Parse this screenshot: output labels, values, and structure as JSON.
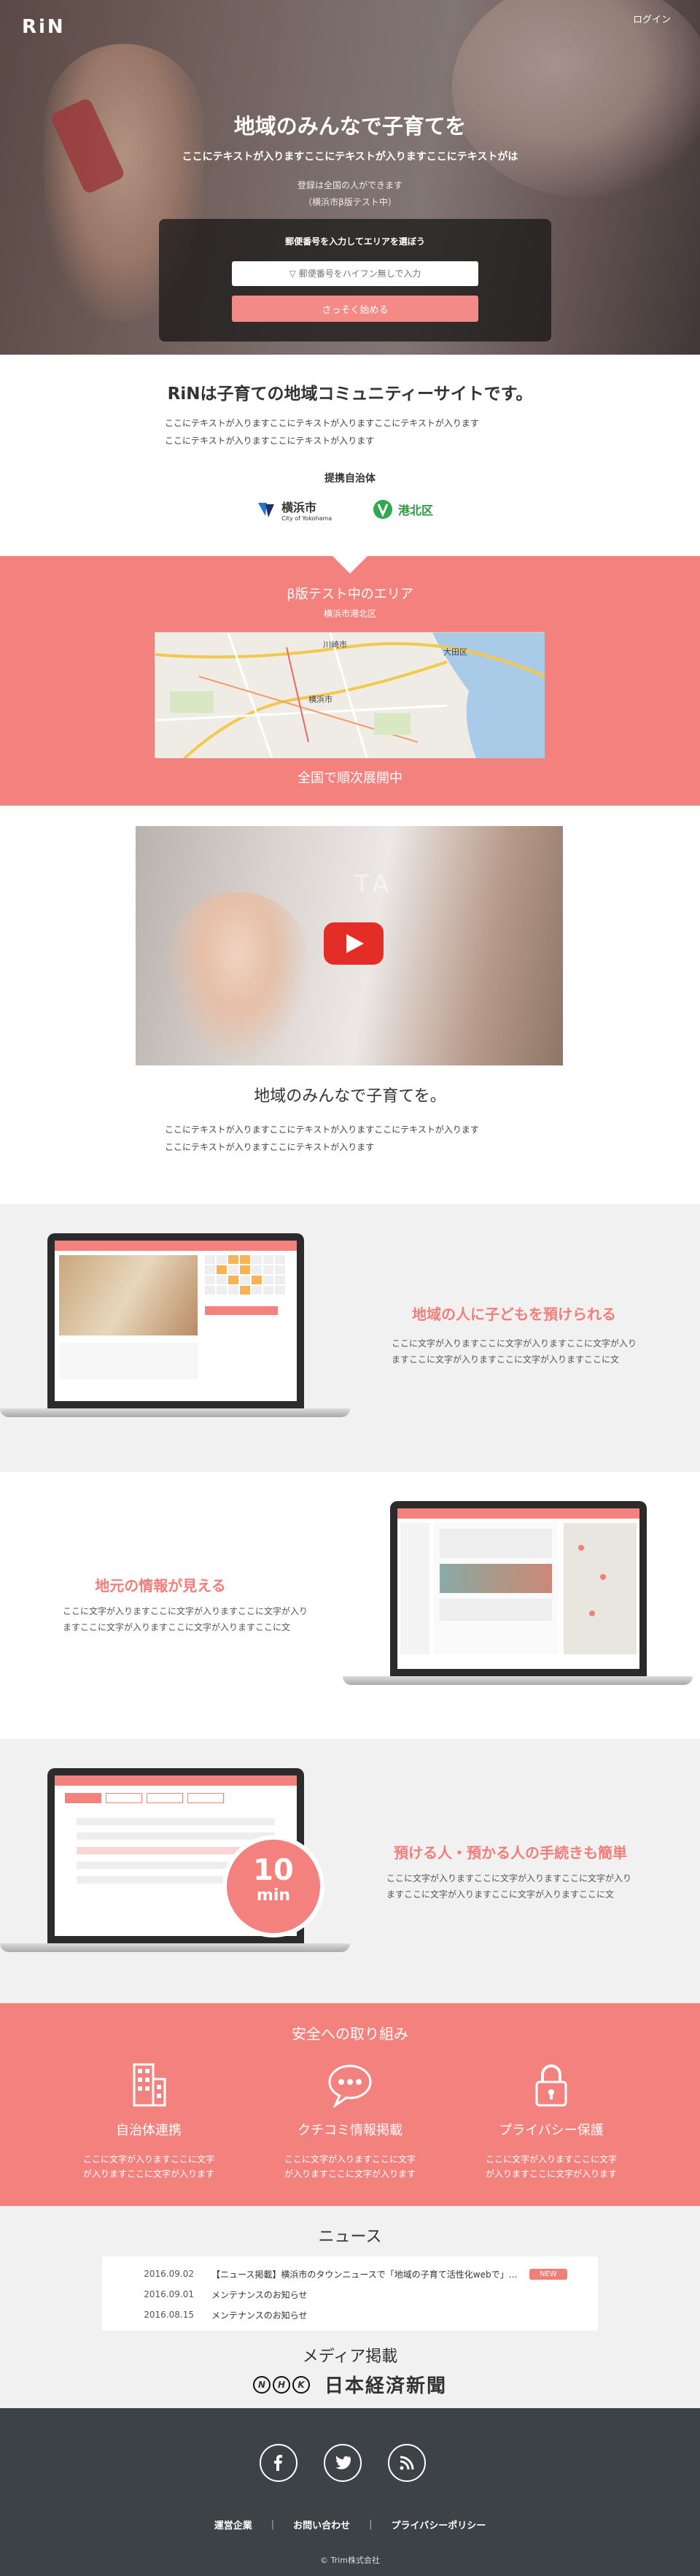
{
  "header": {
    "logo": "RiN",
    "login": "ログイン"
  },
  "hero": {
    "title": "地域のみんなで子育てを",
    "subtitle": "ここにテキストが入りますここにテキストが入りますここにテキストがは",
    "note1": "登録は全国の人ができます",
    "note2": "（横浜市β版テスト中）",
    "panel_label": "郵便番号を入力してエリアを選ぼう",
    "zip_placeholder": "▽ 郵便番号をハイフン無しで入力",
    "start_button": "さっそく始める"
  },
  "intro": {
    "title": "RiNは子育ての地域コミュニティーサイトです。",
    "text1": "ここにテキストが入りますここにテキストが入りますここにテキストが入ります",
    "text2": "ここにテキストが入りますここにテキストが入ります",
    "partners_label": "提携自治体",
    "partners": [
      {
        "name": "横浜市",
        "sub": "City of Yokohama"
      },
      {
        "name": "港北区"
      }
    ]
  },
  "trial": {
    "title": "β版テスト中のエリア",
    "area": "横浜市港北区",
    "map_labels": [
      "川崎市",
      "大田区",
      "横浜市"
    ],
    "footer": "全国で順次展開中"
  },
  "video_section": {
    "title": "地域のみんなで子育てを。",
    "text1": "ここにテキストが入りますここにテキストが入りますここにテキストが入ります",
    "text2": "ここにテキストが入りますここにテキストが入ります",
    "watermark": "TA"
  },
  "features": [
    {
      "title": "地域の人に子どもを預けられる",
      "text1": "ここに文字が入りますここに文字が入りますここに文字が入り",
      "text2": "ますここに文字が入りますここに文字が入りますここに文"
    },
    {
      "title": "地元の情報が見える",
      "text1": "ここに文字が入りますここに文字が入りますここに文字が入り",
      "text2": "ますここに文字が入りますここに文字が入りますここに文"
    },
    {
      "title": "預ける人・預かる人の手続きも簡単",
      "text1": "ここに文字が入りますここに文字が入りますここに文字が入り",
      "text2": "ますここに文字が入りますここに文字が入りますここに文"
    }
  ],
  "badge": {
    "number": "10",
    "unit": "min"
  },
  "safety": {
    "title": "安全への取り組み",
    "items": [
      {
        "title": "自治体連携",
        "text1": "ここに文字が入りますここに文字",
        "text2": "が入りますここに文字が入ります",
        "icon": "building-icon"
      },
      {
        "title": "クチコミ情報掲載",
        "text1": "ここに文字が入りますここに文字",
        "text2": "が入りますここに文字が入ります",
        "icon": "speech-bubble-icon"
      },
      {
        "title": "プライバシー保護",
        "text1": "ここに文字が入りますここに文字",
        "text2": "が入りますここに文字が入ります",
        "icon": "lock-icon"
      }
    ]
  },
  "news": {
    "title": "ニュース",
    "items": [
      {
        "date": "2016.09.02",
        "title": "【ニュース掲載】横浜市のタウンニュースで「地域の子育て活性化webで」と取り…",
        "badge": "NEW"
      },
      {
        "date": "2016.09.01",
        "title": "メンテナンスのお知らせ",
        "badge": ""
      },
      {
        "date": "2016.08.15",
        "title": "メンテナンスのお知らせ",
        "badge": ""
      }
    ]
  },
  "media": {
    "title": "メディア掲載",
    "logos": [
      "NHK",
      "日本経済新聞"
    ]
  },
  "footer": {
    "nav": [
      "運営企業",
      "お問い合わせ",
      "プライバシーポリシー"
    ],
    "social": [
      "f",
      "t",
      "rss"
    ],
    "copyright": "© Trim株式会社"
  },
  "colors": {
    "accent": "#f3827e",
    "footer": "#3d4246",
    "news_bg": "#f1f1f1"
  }
}
